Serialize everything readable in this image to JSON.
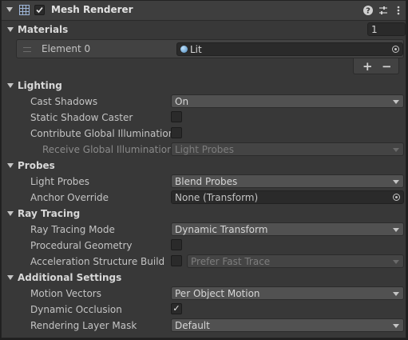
{
  "component": {
    "title": "Mesh Renderer",
    "icons": [
      "help-icon",
      "presets-icon",
      "more-options-icon"
    ]
  },
  "materials": {
    "header": "Materials",
    "count": "1",
    "element_label": "Element 0",
    "element_value": "Lit",
    "add": "+",
    "remove": "−"
  },
  "lighting": {
    "header": "Lighting",
    "cast_shadows": {
      "label": "Cast Shadows",
      "value": "On"
    },
    "static_shadow_caster": {
      "label": "Static Shadow Caster",
      "checked": false
    },
    "contribute_gi": {
      "label": "Contribute Global Illumination",
      "checked": false
    },
    "receive_gi": {
      "label": "Receive Global Illumination",
      "value": "Light Probes"
    }
  },
  "probes": {
    "header": "Probes",
    "light_probes": {
      "label": "Light Probes",
      "value": "Blend Probes"
    },
    "anchor_override": {
      "label": "Anchor Override",
      "value": "None (Transform)"
    }
  },
  "ray_tracing": {
    "header": "Ray Tracing",
    "mode": {
      "label": "Ray Tracing Mode",
      "value": "Dynamic Transform"
    },
    "procedural_geometry": {
      "label": "Procedural Geometry",
      "checked": false
    },
    "accel_build_flags": {
      "label": "Acceleration Structure Build Fla",
      "value": "Prefer Fast Trace",
      "checked": false
    }
  },
  "additional": {
    "header": "Additional Settings",
    "motion_vectors": {
      "label": "Motion Vectors",
      "value": "Per Object Motion"
    },
    "dynamic_occlusion": {
      "label": "Dynamic Occlusion",
      "checked": true,
      "mark": "✓"
    },
    "rendering_layer_mask": {
      "label": "Rendering Layer Mask",
      "value": "Default"
    }
  },
  "colors": {
    "panel": "#383838",
    "field": "#2a2a2a",
    "dropdown": "#515151",
    "text": "#c4c4c4"
  }
}
